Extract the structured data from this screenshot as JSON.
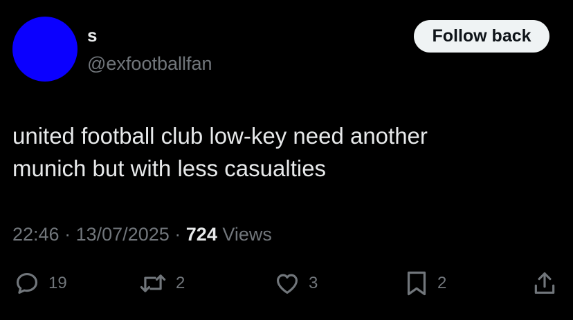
{
  "author": {
    "display_name": "s",
    "handle": "@exfootballfan",
    "avatar_color": "#0b00ff"
  },
  "follow_button": {
    "label": "Follow back"
  },
  "tweet": {
    "lines": [
      "united football club low-key need another",
      "munich but with less casualties"
    ]
  },
  "meta": {
    "time": "22:46",
    "separator": "·",
    "date": "13/07/2025",
    "views_count": "724",
    "views_label": "Views"
  },
  "actions": {
    "reply": {
      "icon": "reply-icon",
      "count": "19"
    },
    "repost": {
      "icon": "repost-icon",
      "count": "2"
    },
    "like": {
      "icon": "heart-icon",
      "count": "3"
    },
    "bookmark": {
      "icon": "bookmark-icon",
      "count": "2"
    },
    "share": {
      "icon": "share-icon"
    }
  },
  "colors": {
    "background": "#000000",
    "primary_text": "#e7e9ea",
    "secondary_text": "#71767b",
    "button_bg": "#eff3f4"
  }
}
